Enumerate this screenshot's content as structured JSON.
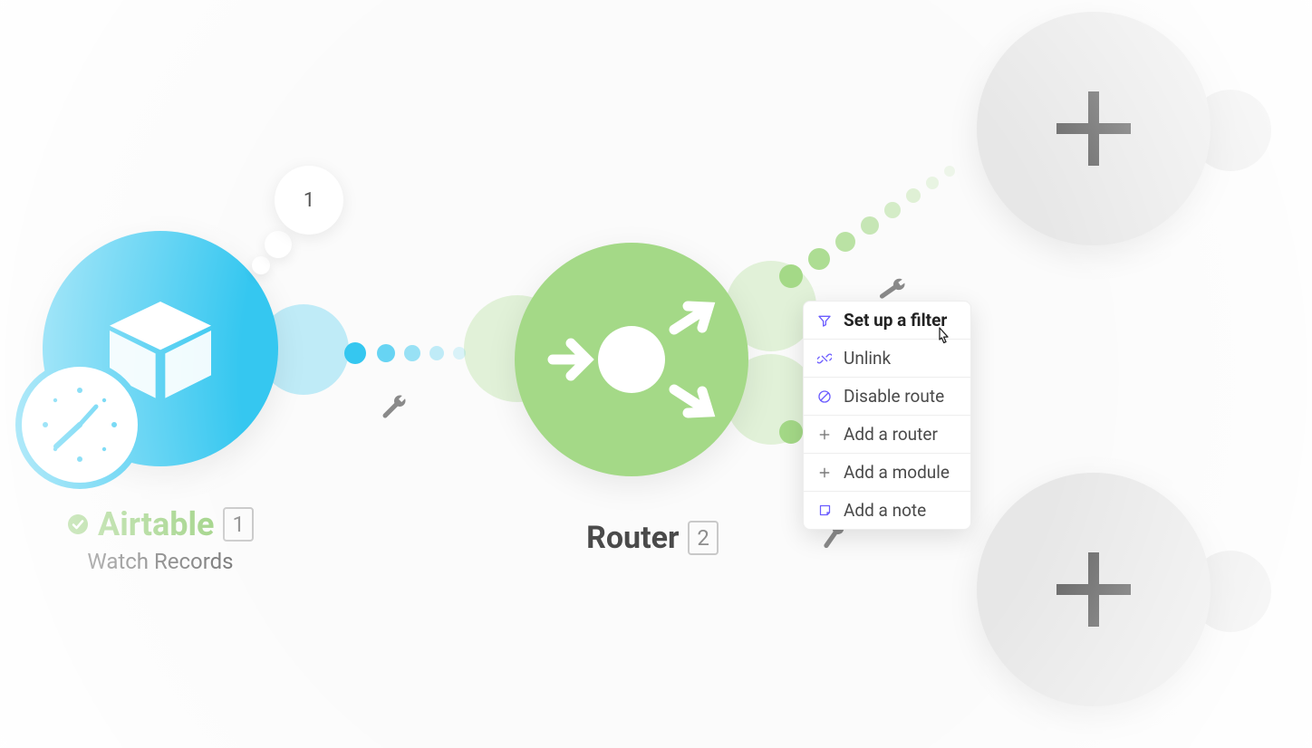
{
  "modules": {
    "airtable": {
      "title": "Airtable",
      "subtitle": "Watch Records",
      "index": "1",
      "bubble_count": "1"
    },
    "router": {
      "title": "Router",
      "index": "2"
    }
  },
  "context_menu": {
    "items": [
      {
        "icon": "filter",
        "label": "Set up a filter",
        "bold": true
      },
      {
        "icon": "unlink",
        "label": "Unlink"
      },
      {
        "icon": "disable",
        "label": "Disable route"
      },
      {
        "icon": "plus",
        "label": "Add a router"
      },
      {
        "icon": "plus",
        "label": "Add a module"
      },
      {
        "icon": "note",
        "label": "Add a note"
      }
    ]
  }
}
